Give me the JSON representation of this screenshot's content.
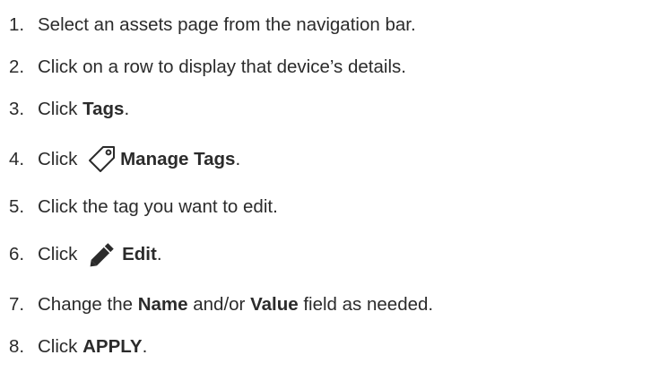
{
  "steps": [
    {
      "number": "1.",
      "parts": {
        "a": "Select an assets page from the navigation bar."
      }
    },
    {
      "number": "2.",
      "parts": {
        "a": "Click on a row to display that device’s details."
      }
    },
    {
      "number": "3.",
      "parts": {
        "a": "Click ",
        "b": "Tags",
        "c": "."
      }
    },
    {
      "number": "4.",
      "parts": {
        "a": "Click ",
        "icon": "tag-outline-icon",
        "b": "Manage Tags",
        "c": "."
      }
    },
    {
      "number": "5.",
      "parts": {
        "a": "Click the tag you want to edit."
      }
    },
    {
      "number": "6.",
      "parts": {
        "a": "Click ",
        "icon": "pencil-icon",
        "b": "Edit",
        "c": "."
      }
    },
    {
      "number": "7.",
      "parts": {
        "a": "Change the ",
        "b": "Name",
        "c": " and/or ",
        "d": "Value",
        "e": " field as needed."
      }
    },
    {
      "number": "8.",
      "parts": {
        "a": "Click ",
        "b": "APPLY",
        "c": "."
      }
    }
  ]
}
